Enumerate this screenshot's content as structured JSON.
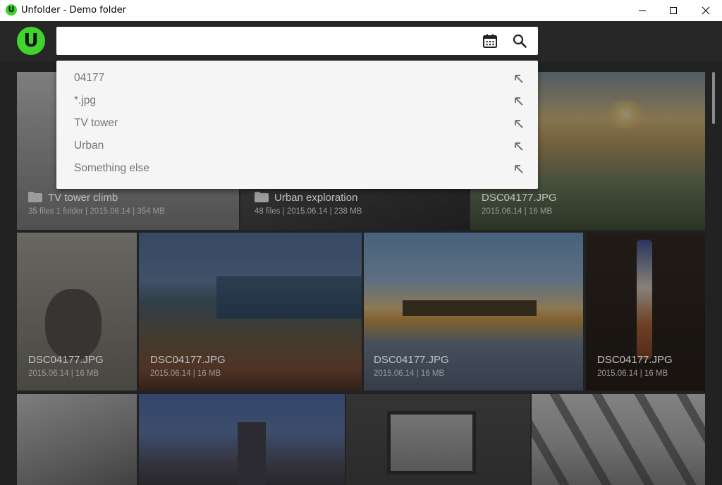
{
  "window": {
    "title": "Unfolder - Demo folder",
    "icon_letter": "U",
    "controls": [
      "minimize-icon",
      "maximize-icon",
      "close-icon"
    ]
  },
  "header": {
    "logo_letter": "U",
    "logo_color": "#3fd52d",
    "search": {
      "value": "",
      "placeholder": ""
    },
    "icons": [
      "calendar-icon",
      "search-icon"
    ]
  },
  "suggestions": {
    "items": [
      {
        "label": "04177"
      },
      {
        "label": "*.jpg"
      },
      {
        "label": "TV tower"
      },
      {
        "label": "Urban"
      },
      {
        "label": "Something else"
      }
    ],
    "item_icon": "arrow-up-left-icon"
  },
  "gallery": {
    "row1": [
      {
        "type": "folder",
        "name": "TV tower climb",
        "meta": "35 files 1 folder  |  2015.06.14  |  354 MB"
      },
      {
        "type": "folder",
        "name": "Urban exploration",
        "meta": "48 files  |  2015.06.14  |  238 MB"
      },
      {
        "type": "image",
        "name": "DSC04177.JPG",
        "meta": "2015.06.14  |  16 MB"
      }
    ],
    "row2": [
      {
        "type": "image",
        "name": "DSC04177.JPG",
        "meta": "2015.06.14  |  16 MB"
      },
      {
        "type": "image",
        "name": "DSC04177.JPG",
        "meta": "2015.06.14  |  16 MB"
      },
      {
        "type": "image",
        "name": "DSC04177.JPG",
        "meta": "2015.06.14  |  16 MB"
      },
      {
        "type": "image",
        "name": "DSC04177.JPG",
        "meta": "2015.06.14  |  16 MB"
      }
    ]
  },
  "colors": {
    "accent": "#3fd52d",
    "background": "#1e1e1e",
    "appbar": "#272727",
    "dropdown": "#f5f5f5"
  }
}
